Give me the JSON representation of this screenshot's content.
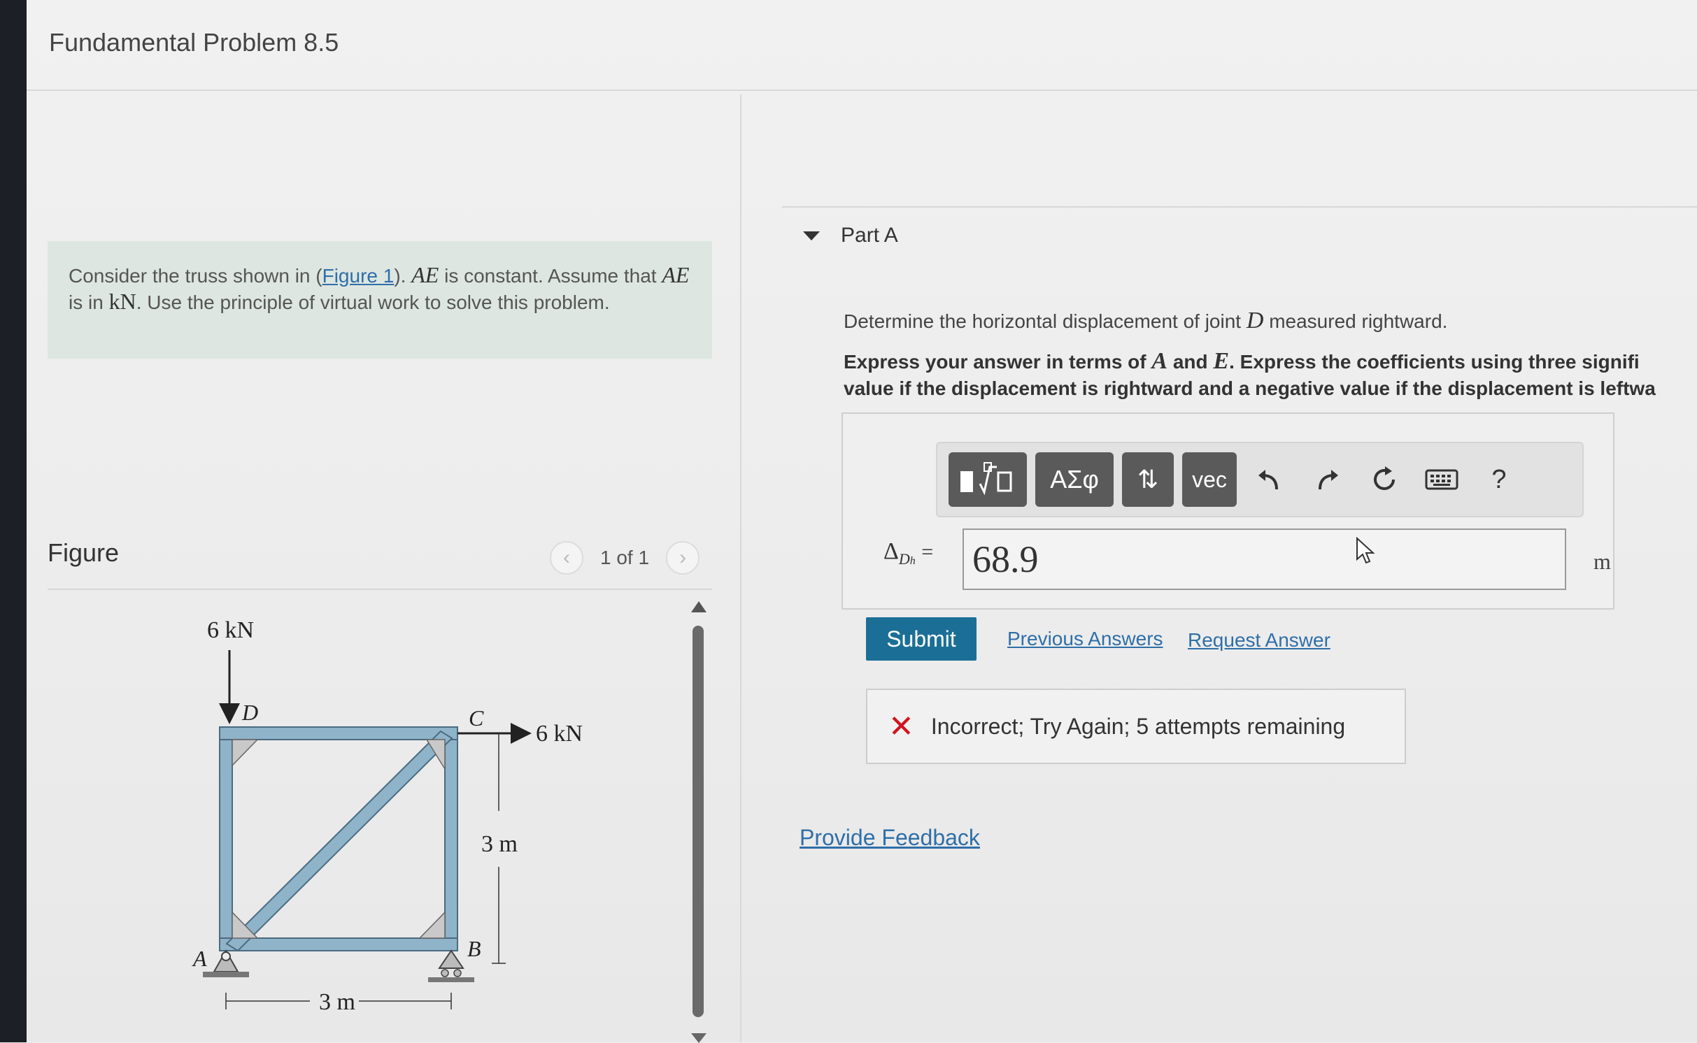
{
  "title": "Fundamental Problem 8.5",
  "intro": {
    "t1": "Consider the truss shown in (",
    "figure_link": "Figure 1",
    "t2": "). ",
    "var_ae": "AE",
    "t3": " is constant. Assume that ",
    "var_ae2": "AE",
    "t4": " is in ",
    "unit_kn": "kN",
    "t5": ". Use the principle of virtual work to solve this problem."
  },
  "figure": {
    "label": "Figure",
    "pager_text": "1 of 1",
    "load_top": "6 kN",
    "load_right": "6 kN",
    "node_d": "D",
    "node_c": "C",
    "node_a": "A",
    "node_b": "B",
    "dim_vertical": "3 m",
    "dim_horizontal": "3 m"
  },
  "part": {
    "header": "Part A",
    "question_pre": "Determine the horizontal displacement of joint ",
    "question_var": "D",
    "question_post": " measured rightward.",
    "instr_1": "Express your answer in terms of ",
    "instr_var_a": "A",
    "instr_and": " and ",
    "instr_var_e": "E",
    "instr_2": ". Express the coefficients using three signifi",
    "instr_3": "value if the displacement is rightward and a negative value if the displacement is leftwa"
  },
  "toolbar": {
    "templates_icon": "fraction-radical-icon",
    "greek": "ΑΣφ",
    "arrows": "⇅",
    "vec": "vec",
    "help": "?"
  },
  "answer": {
    "label_main": "Δ",
    "label_sub": "D",
    "label_subsub": "h",
    "equals": "=",
    "value": "68.9",
    "unit": "m"
  },
  "actions": {
    "submit": "Submit",
    "previous_answers": "Previous Answers",
    "request_answer": "Request Answer"
  },
  "feedback": {
    "message": "Incorrect; Try Again; 5 attempts remaining"
  },
  "provide_feedback": "Provide Feedback"
}
